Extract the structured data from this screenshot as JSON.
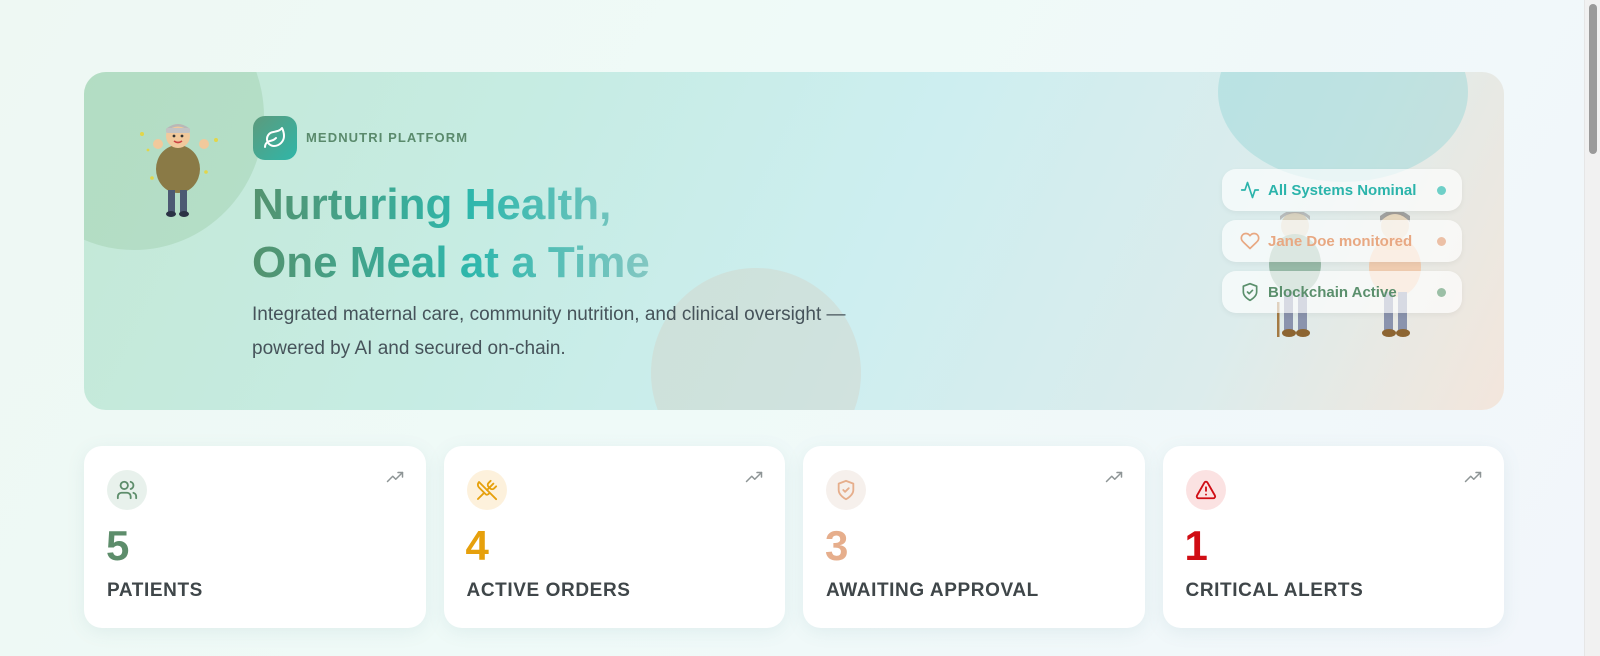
{
  "brand": {
    "name": "MEDNUTRI PLATFORM",
    "logo_icon": "leaf-icon"
  },
  "hero": {
    "title_line1": "Nurturing Health,",
    "title_line2": "One Meal at a Time",
    "subtitle": "Integrated maternal care, community nutrition, and clinical oversight — powered by AI and secured on-chain."
  },
  "status_pills": [
    {
      "label": "All Systems Nominal",
      "icon": "activity-icon",
      "color": "#2bb4ab"
    },
    {
      "label": "Jane Doe monitored",
      "icon": "heart-icon",
      "color": "#e8a882"
    },
    {
      "label": "Blockchain Active",
      "icon": "shield-check-icon",
      "color": "#5a8f6c"
    }
  ],
  "stats": [
    {
      "value": "5",
      "label": "PATIENTS",
      "icon": "users-icon",
      "color": "#5d8d6b",
      "icon_bg": "#e8f1ec"
    },
    {
      "value": "4",
      "label": "ACTIVE ORDERS",
      "icon": "utensils-crossed-icon",
      "color": "#e6a00c",
      "icon_bg": "#fdf1dc"
    },
    {
      "value": "3",
      "label": "AWAITING APPROVAL",
      "icon": "shield-check-icon",
      "color": "#e6ae8c",
      "icon_bg": "#f6f0ec"
    },
    {
      "value": "1",
      "label": "CRITICAL ALERTS",
      "icon": "alert-triangle-icon",
      "color": "#d00d14",
      "icon_bg": "#fbe2e2"
    }
  ],
  "colors": {
    "accent_green": "#5d9a7c",
    "accent_teal": "#2fb6a8"
  }
}
